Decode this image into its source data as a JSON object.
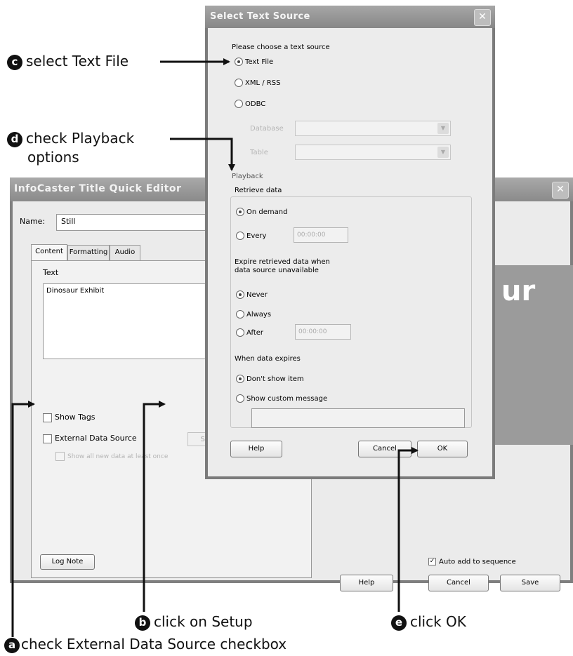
{
  "editor": {
    "title": "InfoCaster Title Quick Editor",
    "name_label": "Name:",
    "name_value": "Still",
    "tabs": [
      {
        "label": "Content"
      },
      {
        "label": "Formatting"
      },
      {
        "label": "Audio"
      }
    ],
    "text_label": "Text",
    "text_value": "Dinosaur Exhibit",
    "show_tags_label": "Show Tags",
    "external_source_label": "External Data Source",
    "setup_label": "Setup",
    "show_all_label": "Show all new data at least once",
    "log_note_label": "Log Note",
    "preview_text": "ur",
    "auto_add_label": "Auto add to sequence",
    "help_label": "Help",
    "cancel_label": "Cancel",
    "save_label": "Save"
  },
  "dialog": {
    "title": "Select Text Source",
    "prompt": "Please choose a text source",
    "sources": [
      {
        "label": "Text File",
        "selected": true
      },
      {
        "label": "XML / RSS",
        "selected": false
      },
      {
        "label": "ODBC",
        "selected": false
      }
    ],
    "database_label": "Database",
    "table_label": "Table",
    "playback_label": "Playback",
    "retrieve_label": "Retrieve data",
    "on_demand_label": "On demand",
    "every_label": "Every",
    "every_value": "00:00:00",
    "expire_label_line1": "Expire retrieved data when",
    "expire_label_line2": "data source unavailable",
    "never_label": "Never",
    "always_label": "Always",
    "after_label": "After",
    "after_value": "00:00:00",
    "when_expires_label": "When data expires",
    "dont_show_label": "Don't show item",
    "show_custom_label": "Show custom message",
    "help_label": "Help",
    "cancel_label": "Cancel",
    "ok_label": "OK"
  },
  "annotations": {
    "a": {
      "letter": "a",
      "text": "check External Data Source checkbox"
    },
    "b": {
      "letter": "b",
      "text": "click on Setup"
    },
    "c": {
      "letter": "c",
      "text": "select Text File"
    },
    "d": {
      "letter": "d",
      "text_line1": "check Playback",
      "text_line2": "options"
    },
    "e": {
      "letter": "e",
      "text": "click OK"
    }
  },
  "colors": {
    "titlebar": "#8f8f8f",
    "window_bg": "#ebebeb",
    "preview_bg": "#9b9b9b",
    "annotation_badge": "#111111"
  }
}
